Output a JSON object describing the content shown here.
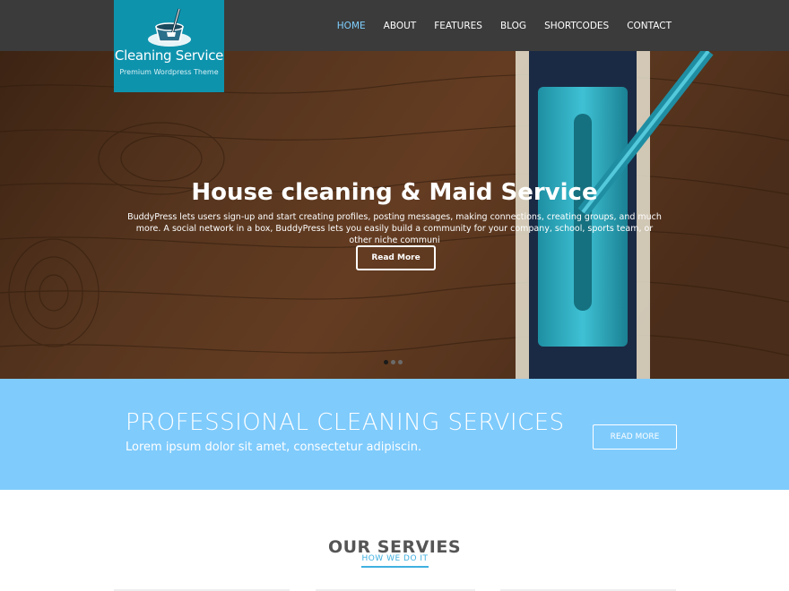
{
  "header": {
    "logo": {
      "title": "Cleaning Service",
      "tagline": "Premium Wordpress Theme",
      "bg_color": "#0e93ad",
      "icon": "mop-bucket-icon"
    },
    "nav": [
      {
        "label": "HOME",
        "active": true
      },
      {
        "label": "ABOUT"
      },
      {
        "label": "FEATURES"
      },
      {
        "label": "BLOG"
      },
      {
        "label": "SHORTCODES"
      },
      {
        "label": "CONTACT"
      }
    ],
    "bg_color": "#3b3b3b",
    "active_color": "#7fd0ff"
  },
  "hero": {
    "title": "House cleaning & Maid Service",
    "text": "BuddyPress lets users sign-up and start creating profiles, posting messages, making connections, creating groups, and much more. A social network in a box, BuddyPress lets you easily build a community for your company, school, sports team, or other niche communi",
    "button": "Read More",
    "slides_count": 3,
    "active_slide": 1
  },
  "cta": {
    "title": "PROFESSIONAL CLEANING SERVICES",
    "subtitle": "Lorem ipsum dolor sit amet, consectetur adipiscin.",
    "button": "READ MORE",
    "bg_color": "#7fcbfc"
  },
  "services": {
    "title": "OUR SERVIES",
    "subtitle": "HOW WE DO IT",
    "accent_color": "#3fb0e0"
  }
}
